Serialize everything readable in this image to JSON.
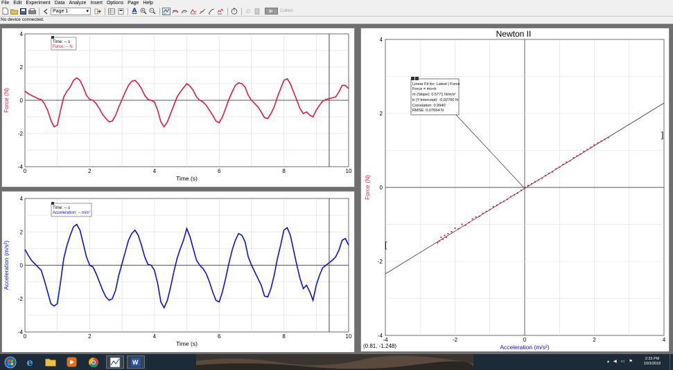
{
  "menu": [
    "File",
    "Edit",
    "Experiment",
    "Data",
    "Analyze",
    "Insert",
    "Options",
    "Page",
    "Help"
  ],
  "toolbar": {
    "page_label": "Page 1",
    "collect_label": "Collect"
  },
  "status": {
    "text": "No device connected."
  },
  "force_graph": {
    "tooltip_time": "Time: -- s",
    "tooltip_value": "Force: -- N",
    "xlabel": "Time (s)",
    "ylabel": "Force (N)",
    "x_ticks": [
      "0",
      "2",
      "4",
      "6",
      "8",
      "10"
    ],
    "y_ticks": [
      "4",
      "2",
      "0",
      "-2",
      "-4"
    ],
    "xlim": [
      0,
      10
    ],
    "ylim": [
      -4,
      4
    ],
    "color": "#e8183c",
    "cursor_x": 9.4
  },
  "accel_graph": {
    "tooltip_time": "Time: -- s",
    "tooltip_value": "Acceleration: -- m/s²",
    "xlabel": "Time (s)",
    "ylabel": "Acceleration (m/s²)",
    "x_ticks": [
      "0",
      "2",
      "4",
      "6",
      "8",
      "10"
    ],
    "y_ticks": [
      "4",
      "2",
      "0",
      "-2",
      "-4"
    ],
    "xlim": [
      0,
      10
    ],
    "ylim": [
      -4,
      4
    ],
    "color": "#0a10d8",
    "cursor_x": 9.4
  },
  "newton_graph": {
    "title": "Newton II",
    "xlabel": "Acceleration (m/s²)",
    "ylabel": "Force (N)",
    "x_ticks": [
      "-4",
      "-2",
      "0",
      "2",
      "4"
    ],
    "y_ticks": [
      "4",
      "2",
      "0",
      "-2",
      "-4"
    ],
    "xlim": [
      -4,
      4
    ],
    "ylim": [
      -4,
      4
    ],
    "fit_title": "Linear Fit for: Latest | Force",
    "fit_eq": "Force = mx+b",
    "fit_slope": "m (Slope): 0.5771 N/m/s²",
    "fit_intercept": "b (Y-Intercept): -0.02760 N",
    "fit_corr": "Correlation: 0.9940",
    "fit_rmse": "RMSE: 0.07654 N",
    "coords": "(0.81, -1.248)",
    "slope": 0.5771,
    "intercept": -0.0276,
    "bracket_left": "[",
    "bracket_right": "]"
  },
  "chart_data": [
    {
      "type": "line",
      "title": "",
      "xlabel": "Time (s)",
      "ylabel": "Force (N)",
      "xlim": [
        0,
        10
      ],
      "ylim": [
        -4,
        4
      ],
      "series": [
        {
          "x": [
            0,
            0.1,
            0.2,
            0.3,
            0.4,
            0.5,
            0.6,
            0.7,
            0.8,
            0.9,
            1.0,
            1.1,
            1.2,
            1.3,
            1.4,
            1.5,
            1.6,
            1.7,
            1.8,
            1.9,
            2.0,
            2.1,
            2.2,
            2.3,
            2.4,
            2.5,
            2.6,
            2.7,
            2.8,
            2.9,
            3.0,
            3.1,
            3.2,
            3.3,
            3.4,
            3.5,
            3.6,
            3.7,
            3.8,
            3.9,
            4.0,
            4.1,
            4.2,
            4.3,
            4.4,
            4.5,
            4.6,
            4.7,
            4.8,
            4.9,
            5.0,
            5.1,
            5.2,
            5.3,
            5.4,
            5.5,
            5.6,
            5.7,
            5.8,
            5.9,
            6.0,
            6.1,
            6.2,
            6.3,
            6.4,
            6.5,
            6.6,
            6.7,
            6.8,
            6.9,
            7.0,
            7.1,
            7.2,
            7.3,
            7.4,
            7.5,
            7.6,
            7.7,
            7.8,
            7.9,
            8.0,
            8.1,
            8.2,
            8.3,
            8.4,
            8.5,
            8.6,
            8.7,
            8.8,
            8.9,
            9.0,
            9.1,
            9.2,
            9.3,
            9.4,
            9.5,
            9.6,
            9.7,
            9.8,
            9.9,
            10.0
          ],
          "y": [
            0.55,
            0.4,
            0.3,
            0.2,
            0.1,
            0.05,
            -0.2,
            -0.6,
            -1.2,
            -1.6,
            -1.5,
            -0.6,
            0.2,
            0.55,
            0.8,
            1.2,
            1.35,
            1.2,
            0.8,
            0.3,
            0.05,
            0.0,
            -0.2,
            -0.5,
            -0.85,
            -1.1,
            -1.3,
            -1.25,
            -0.9,
            -0.4,
            0.05,
            0.5,
            0.9,
            1.15,
            1.2,
            1.0,
            0.7,
            0.3,
            0.05,
            0.0,
            -0.1,
            -0.6,
            -1.3,
            -1.6,
            -1.3,
            -0.8,
            -0.3,
            0.2,
            0.5,
            0.75,
            1.0,
            0.85,
            0.6,
            0.2,
            0.0,
            -0.1,
            -0.3,
            -0.6,
            -0.9,
            -1.25,
            -1.35,
            -1.0,
            -0.5,
            0.05,
            0.5,
            0.9,
            1.05,
            1.0,
            0.8,
            0.3,
            0.0,
            -0.2,
            -0.4,
            -0.7,
            -1.05,
            -1.1,
            -0.8,
            -0.4,
            0.2,
            0.7,
            1.2,
            1.3,
            1.0,
            0.5,
            0.0,
            -0.5,
            -0.8,
            -0.7,
            -0.9,
            -1.0,
            -0.6,
            -0.3,
            -0.05,
            0.05,
            0.1,
            0.15,
            0.2,
            0.5,
            0.9,
            0.9,
            0.7
          ]
        }
      ]
    },
    {
      "type": "line",
      "title": "",
      "xlabel": "Time (s)",
      "ylabel": "Acceleration (m/s²)",
      "xlim": [
        0,
        10
      ],
      "ylim": [
        -4,
        4
      ],
      "series": [
        {
          "x": [
            0,
            0.1,
            0.2,
            0.3,
            0.4,
            0.5,
            0.6,
            0.7,
            0.8,
            0.9,
            1.0,
            1.1,
            1.2,
            1.3,
            1.4,
            1.5,
            1.6,
            1.7,
            1.8,
            1.9,
            2.0,
            2.1,
            2.2,
            2.3,
            2.4,
            2.5,
            2.6,
            2.7,
            2.8,
            2.9,
            3.0,
            3.1,
            3.2,
            3.3,
            3.4,
            3.5,
            3.6,
            3.7,
            3.8,
            3.9,
            4.0,
            4.1,
            4.2,
            4.3,
            4.4,
            4.5,
            4.6,
            4.7,
            4.8,
            4.9,
            5.0,
            5.1,
            5.2,
            5.3,
            5.4,
            5.5,
            5.6,
            5.7,
            5.8,
            5.9,
            6.0,
            6.1,
            6.2,
            6.3,
            6.4,
            6.5,
            6.6,
            6.7,
            6.8,
            6.9,
            7.0,
            7.1,
            7.2,
            7.3,
            7.4,
            7.5,
            7.6,
            7.7,
            7.8,
            7.9,
            8.0,
            8.1,
            8.2,
            8.3,
            8.4,
            8.5,
            8.6,
            8.7,
            8.8,
            8.9,
            9.0,
            9.1,
            9.2,
            9.3,
            9.4,
            9.5,
            9.6,
            9.7,
            9.8,
            9.9,
            10.0
          ],
          "y": [
            0.95,
            0.6,
            0.3,
            0.1,
            -0.1,
            -0.3,
            -0.9,
            -1.6,
            -2.3,
            -2.45,
            -2.3,
            -1.0,
            0.4,
            1.2,
            1.8,
            2.3,
            2.45,
            2.1,
            1.3,
            0.5,
            0.0,
            -0.1,
            -0.5,
            -1.0,
            -1.5,
            -1.9,
            -2.1,
            -2.0,
            -1.5,
            -0.6,
            0.1,
            0.8,
            1.5,
            1.9,
            2.1,
            1.8,
            1.2,
            0.5,
            0.05,
            0.0,
            -0.3,
            -1.1,
            -2.2,
            -2.55,
            -2.1,
            -1.3,
            -0.4,
            0.4,
            1.0,
            1.5,
            2.2,
            1.7,
            1.0,
            0.3,
            0.0,
            -0.2,
            -0.5,
            -1.0,
            -1.6,
            -2.1,
            -2.2,
            -1.6,
            -0.8,
            0.1,
            0.9,
            1.5,
            1.9,
            1.8,
            1.4,
            0.5,
            0.0,
            -0.4,
            -0.8,
            -1.2,
            -1.85,
            -1.9,
            -1.4,
            -0.6,
            0.4,
            1.2,
            2.1,
            2.25,
            1.8,
            0.9,
            0.0,
            -0.8,
            -1.4,
            -1.2,
            -1.6,
            -2.1,
            -1.2,
            -0.6,
            -0.15,
            0.0,
            0.15,
            0.3,
            0.5,
            0.9,
            1.5,
            1.6,
            1.2
          ]
        }
      ]
    },
    {
      "type": "scatter",
      "title": "Newton II",
      "xlabel": "Acceleration (m/s²)",
      "ylabel": "Force (N)",
      "xlim": [
        -4,
        4
      ],
      "ylim": [
        -4,
        4
      ],
      "series": [
        {
          "name": "Latest",
          "x": [
            -2.5,
            -2.45,
            -2.4,
            -2.35,
            -2.3,
            -2.25,
            -2.2,
            -2.1,
            -2.0,
            -1.9,
            -1.8,
            -1.7,
            -1.6,
            -1.5,
            -1.4,
            -1.3,
            -1.2,
            -1.1,
            -1.0,
            -0.9,
            -0.8,
            -0.7,
            -0.6,
            -0.5,
            -0.4,
            -0.3,
            -0.2,
            -0.1,
            0.0,
            0.1,
            0.2,
            0.3,
            0.4,
            0.5,
            0.6,
            0.7,
            0.8,
            0.9,
            1.0,
            1.1,
            1.2,
            1.3,
            1.4,
            1.5,
            1.6,
            1.7,
            1.8,
            1.9,
            2.0,
            2.1,
            2.2,
            2.3,
            2.4
          ],
          "y": [
            -1.5,
            -1.45,
            -1.35,
            -1.4,
            -1.3,
            -1.35,
            -1.25,
            -1.2,
            -1.1,
            -1.12,
            -1.0,
            -1.02,
            -0.95,
            -0.85,
            -0.8,
            -0.78,
            -0.7,
            -0.65,
            -0.6,
            -0.52,
            -0.48,
            -0.42,
            -0.38,
            -0.32,
            -0.25,
            -0.2,
            -0.15,
            -0.08,
            0.0,
            0.05,
            0.1,
            0.15,
            0.2,
            0.25,
            0.32,
            0.38,
            0.42,
            0.5,
            0.55,
            0.62,
            0.68,
            0.72,
            0.8,
            0.85,
            0.9,
            0.97,
            1.02,
            1.08,
            1.15,
            1.2,
            1.25,
            1.3,
            1.35
          ]
        }
      ]
    }
  ],
  "taskbar": {
    "time": "2:23 PM",
    "date": "10/3/2018"
  }
}
